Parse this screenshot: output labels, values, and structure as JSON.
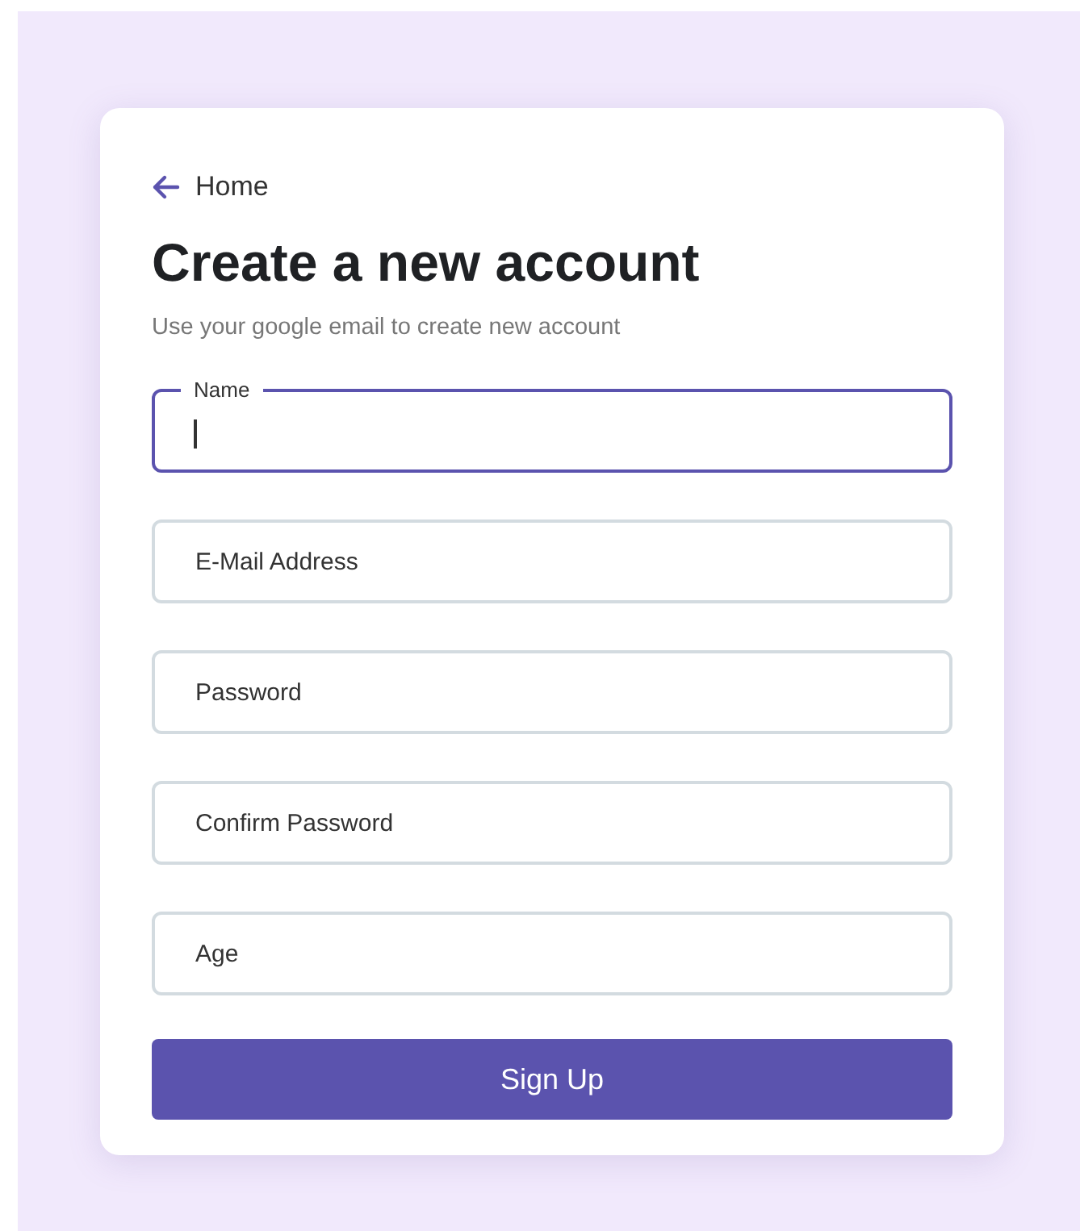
{
  "back_link": {
    "label": "Home"
  },
  "title": "Create a new account",
  "subtitle": "Use your google email to create new account",
  "fields": [
    {
      "label": "Name",
      "focused": true
    },
    {
      "placeholder": "E-Mail Address",
      "focused": false
    },
    {
      "placeholder": "Password",
      "focused": false
    },
    {
      "placeholder": "Confirm Password",
      "focused": false
    },
    {
      "placeholder": "Age",
      "focused": false
    }
  ],
  "submit_button": {
    "label": "Sign Up"
  }
}
